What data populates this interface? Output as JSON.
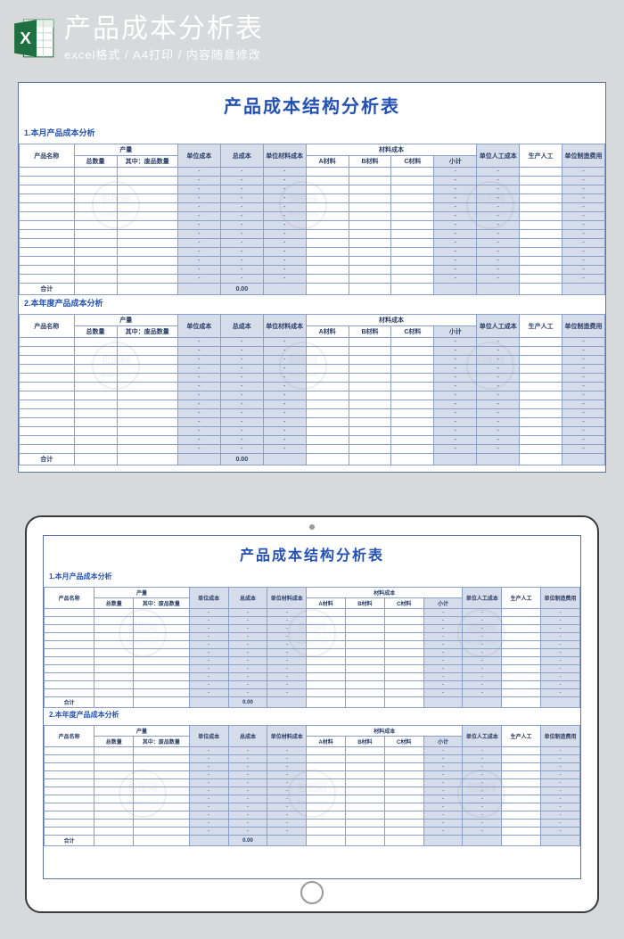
{
  "header": {
    "title": "产品成本分析表",
    "subtitle": "excel格式 / A4打印 / 内容随意修改"
  },
  "doc": {
    "title": "产品成本结构分析表",
    "section1": "1.本月产品成本分析",
    "section2": "2.本年度产品成本分析",
    "cols": {
      "name": "产品名称",
      "qty": "产量",
      "qty_total": "总数量",
      "qty_wp": "其中：废品数量",
      "unit_cost": "单位成本",
      "total_cost": "总成本",
      "unit_mat": "单位材料成本",
      "mat_cost": "材料成本",
      "matA": "A材料",
      "matB": "B材料",
      "matC": "C材料",
      "subtotal": "小计",
      "unit_labor": "单位人工成本",
      "labor": "生产人工",
      "unit_mfg": "单位制造费用"
    },
    "total_label": "合计",
    "total_value": "0.00",
    "dash": "-"
  },
  "watermark": "包图网"
}
